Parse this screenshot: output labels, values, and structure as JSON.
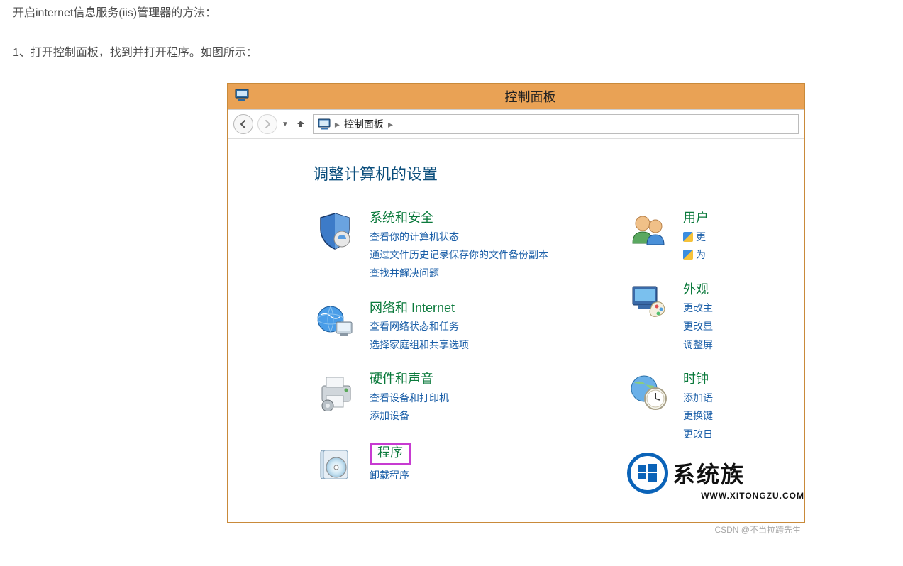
{
  "article": {
    "intro": "开启internet信息服务(iis)管理器的方法：",
    "step1": "1、打开控制面板，找到并打开程序。如图所示："
  },
  "window": {
    "title": "控制面板",
    "breadcrumb": {
      "root": "控制面板",
      "sep": "▸"
    },
    "heading": "调整计算机的设置"
  },
  "categories_left": [
    {
      "icon": "shield",
      "title": "系统和安全",
      "subs": [
        "查看你的计算机状态",
        "通过文件历史记录保存你的文件备份副本",
        "查找并解决问题"
      ]
    },
    {
      "icon": "globe",
      "title": "网络和 Internet",
      "subs": [
        "查看网络状态和任务",
        "选择家庭组和共享选项"
      ]
    },
    {
      "icon": "printer",
      "title": "硬件和声音",
      "subs": [
        "查看设备和打印机",
        "添加设备"
      ]
    },
    {
      "icon": "disc",
      "title": "程序",
      "subs": [
        "卸载程序"
      ],
      "highlight": true
    }
  ],
  "categories_right": [
    {
      "icon": "users",
      "title": "用户",
      "subs": [
        "更",
        "为"
      ],
      "shield": true
    },
    {
      "icon": "palette",
      "title": "外观",
      "subs": [
        "更改主",
        "更改显",
        "调整屏"
      ]
    },
    {
      "icon": "clock",
      "title": "时钟",
      "subs": [
        "添加语",
        "更换键",
        "更改日"
      ]
    }
  ],
  "watermark": {
    "brand": "系统族",
    "url": "WWW.XITONGZU.COM"
  },
  "footer": {
    "csdn": "CSDN @不当拉跨先生"
  }
}
